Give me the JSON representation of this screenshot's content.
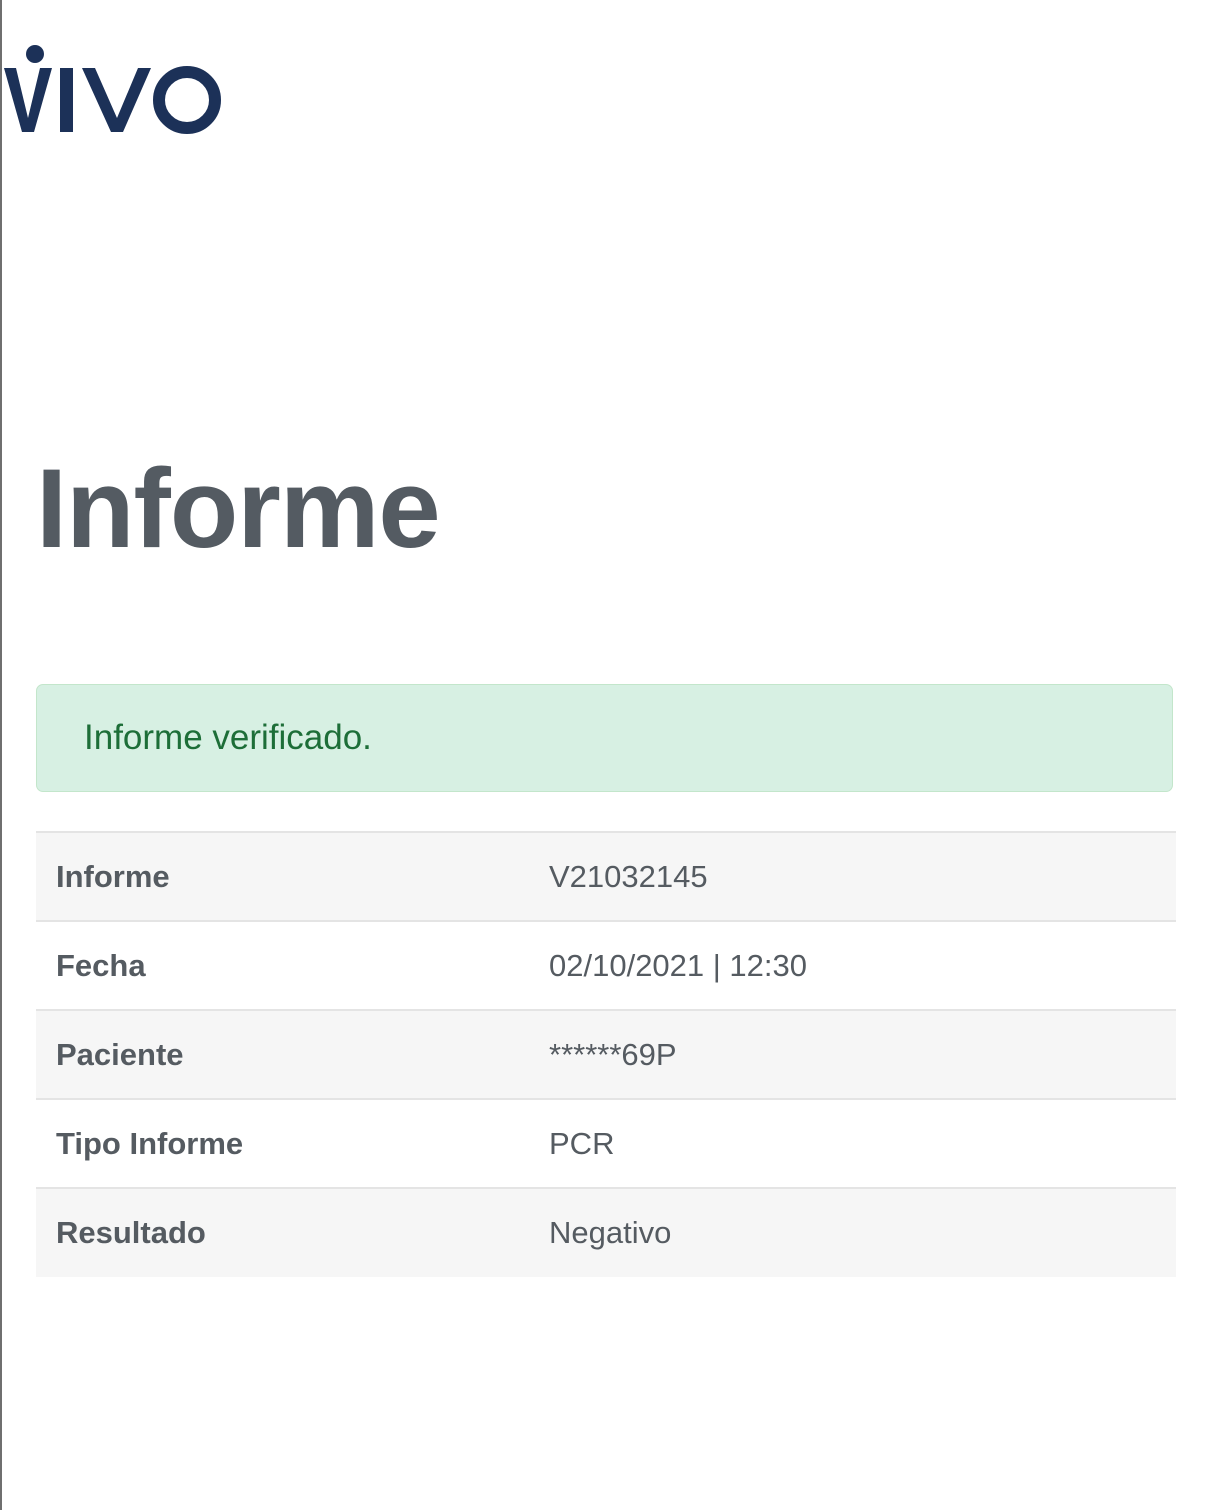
{
  "brand": {
    "logo_text": "VIVO",
    "logo_color": "#1c3158"
  },
  "page_title": "Informe",
  "alert": {
    "text": "Informe verificado.",
    "background": "#d7f0e3",
    "text_color": "#1d6e38"
  },
  "details": [
    {
      "label": "Informe",
      "value": "V21032145"
    },
    {
      "label": "Fecha",
      "value": "02/10/2021 | 12:30"
    },
    {
      "label": "Paciente",
      "value": "******69P"
    },
    {
      "label": "Tipo Informe",
      "value": "PCR"
    },
    {
      "label": "Resultado",
      "value": "Negativo"
    }
  ]
}
